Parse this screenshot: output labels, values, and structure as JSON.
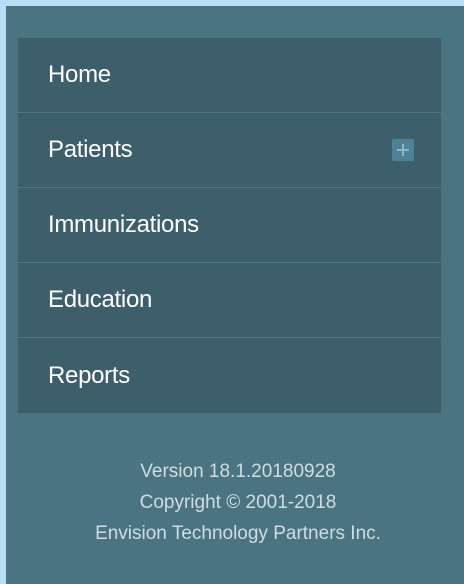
{
  "nav": {
    "items": [
      {
        "label": "Home"
      },
      {
        "label": "Patients",
        "expand_icon": "plus-icon"
      },
      {
        "label": "Immunizations"
      },
      {
        "label": "Education"
      },
      {
        "label": "Reports"
      }
    ]
  },
  "footer": {
    "version": "Version 18.1.20180928",
    "copyright": "Copyright © 2001-2018",
    "company": "Envision Technology Partners Inc."
  },
  "colors": {
    "page_background": "#b9ddf7",
    "panel_background": "#4a7482",
    "nav_background": "#3c5f6b",
    "nav_divider": "#4d7785",
    "expand_button": "#4e8296"
  }
}
